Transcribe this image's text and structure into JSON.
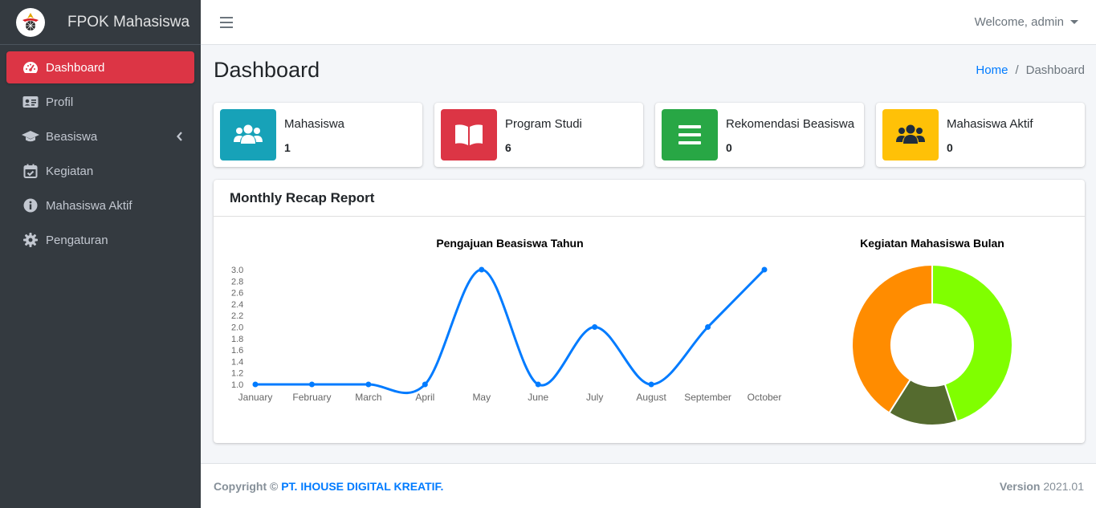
{
  "brand": {
    "name": "FPOK Mahasiswa",
    "logo_icon": "university-logo-icon"
  },
  "sidebar": {
    "items": [
      {
        "label": "Dashboard",
        "icon": "tachometer-icon",
        "active": true
      },
      {
        "label": "Profil",
        "icon": "id-card-icon"
      },
      {
        "label": "Beasiswa",
        "icon": "graduation-cap-icon",
        "has_submenu": true
      },
      {
        "label": "Kegiatan",
        "icon": "calendar-check-icon"
      },
      {
        "label": "Mahasiswa Aktif",
        "icon": "info-circle-icon"
      },
      {
        "label": "Pengaturan",
        "icon": "gear-icon"
      }
    ]
  },
  "topbar": {
    "user_label": "Welcome, admin"
  },
  "header": {
    "title": "Dashboard",
    "breadcrumb_home": "Home",
    "breadcrumb_current": "Dashboard",
    "breadcrumb_sep": "/"
  },
  "info_boxes": [
    {
      "label": "Mahasiswa",
      "value": "1",
      "color": "#17a2b8",
      "icon": "users-icon"
    },
    {
      "label": "Program Studi",
      "value": "6",
      "color": "#dc3545",
      "icon": "book-open-icon"
    },
    {
      "label": "Rekomendasi Beasiswa",
      "value": "0",
      "color": "#28a745",
      "icon": "list-icon"
    },
    {
      "label": "Mahasiswa Aktif",
      "value": "0",
      "color": "#ffc107",
      "icon": "users-icon"
    }
  ],
  "card": {
    "title": "Monthly Recap Report"
  },
  "chart_data": [
    {
      "type": "line",
      "title": "Pengajuan Beasiswa Tahun",
      "categories": [
        "January",
        "February",
        "March",
        "April",
        "May",
        "June",
        "July",
        "August",
        "September",
        "October"
      ],
      "values": [
        1,
        1,
        1,
        1,
        3,
        1,
        2,
        1,
        2,
        3
      ],
      "ylim": [
        1.0,
        3.0
      ],
      "yticks": [
        "1.0",
        "1.2",
        "1.4",
        "1.6",
        "1.8",
        "2.0",
        "2.2",
        "2.4",
        "2.6",
        "2.8",
        "3.0"
      ],
      "color": "#007bff",
      "legend": false,
      "grid": false
    },
    {
      "type": "pie",
      "title": "Kegiatan Mahasiswa Bulan",
      "values": [
        45,
        14,
        41
      ],
      "colors": [
        "#80ff00",
        "#556b2f",
        "#ff8c00"
      ],
      "donut": true
    }
  ],
  "footer": {
    "copyright_prefix": "Copyright ©",
    "company": "PT. IHOUSE DIGITAL KREATIF.",
    "version_label": "Version",
    "version": "2021.01"
  }
}
